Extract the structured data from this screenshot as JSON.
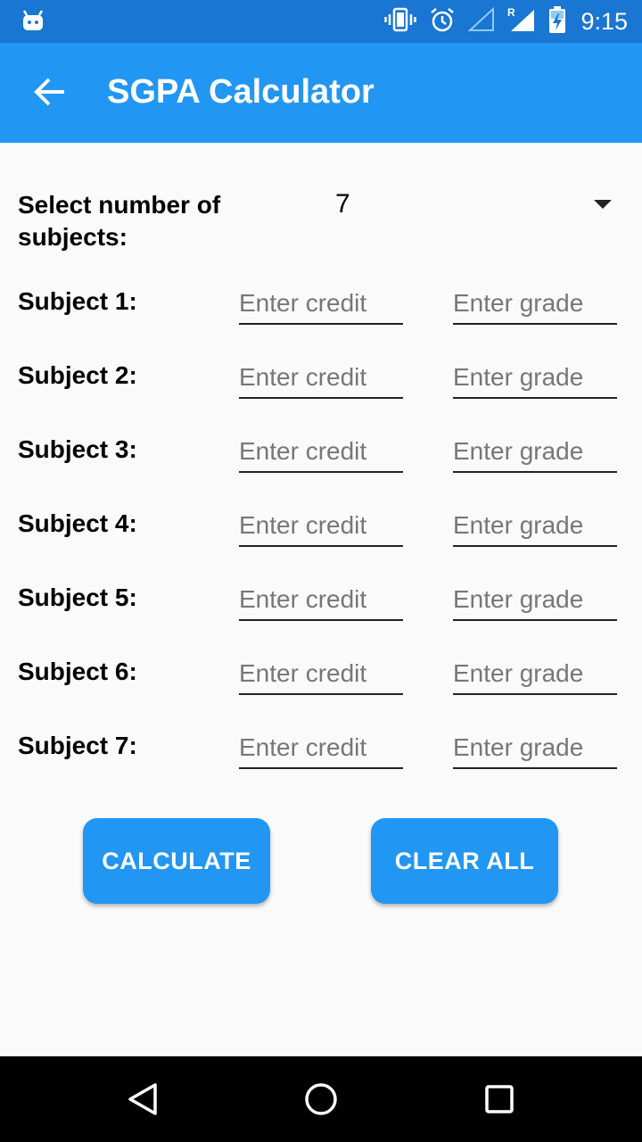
{
  "status_bar": {
    "time": "9:15",
    "icons": [
      "android-debug-icon",
      "vibrate-icon",
      "alarm-icon",
      "wifi-off-icon",
      "signal-roaming-icon",
      "battery-charging-icon"
    ]
  },
  "app_bar": {
    "title": "SGPA Calculator",
    "back_icon": "arrow-back-icon"
  },
  "selector": {
    "label": "Select number of subjects:",
    "value": "7"
  },
  "subjects": [
    {
      "label": "Subject 1:",
      "credit_placeholder": "Enter credit",
      "grade_placeholder": "Enter grade",
      "credit_value": "",
      "grade_value": ""
    },
    {
      "label": "Subject 2:",
      "credit_placeholder": "Enter credit",
      "grade_placeholder": "Enter grade",
      "credit_value": "",
      "grade_value": ""
    },
    {
      "label": "Subject 3:",
      "credit_placeholder": "Enter credit",
      "grade_placeholder": "Enter grade",
      "credit_value": "",
      "grade_value": ""
    },
    {
      "label": "Subject 4:",
      "credit_placeholder": "Enter credit",
      "grade_placeholder": "Enter grade",
      "credit_value": "",
      "grade_value": ""
    },
    {
      "label": "Subject 5:",
      "credit_placeholder": "Enter credit",
      "grade_placeholder": "Enter grade",
      "credit_value": "",
      "grade_value": ""
    },
    {
      "label": "Subject 6:",
      "credit_placeholder": "Enter credit",
      "grade_placeholder": "Enter grade",
      "credit_value": "",
      "grade_value": ""
    },
    {
      "label": "Subject 7:",
      "credit_placeholder": "Enter credit",
      "grade_placeholder": "Enter grade",
      "credit_value": "",
      "grade_value": ""
    }
  ],
  "buttons": {
    "calculate": "CALCULATE",
    "clear_all": "CLEAR ALL"
  },
  "nav_bar": {
    "icons": [
      "back-triangle-icon",
      "home-circle-icon",
      "recents-square-icon"
    ]
  },
  "colors": {
    "status_bar": "#1976d2",
    "app_bar": "#2196f3",
    "button": "#2196f3",
    "background": "#fafafa"
  }
}
